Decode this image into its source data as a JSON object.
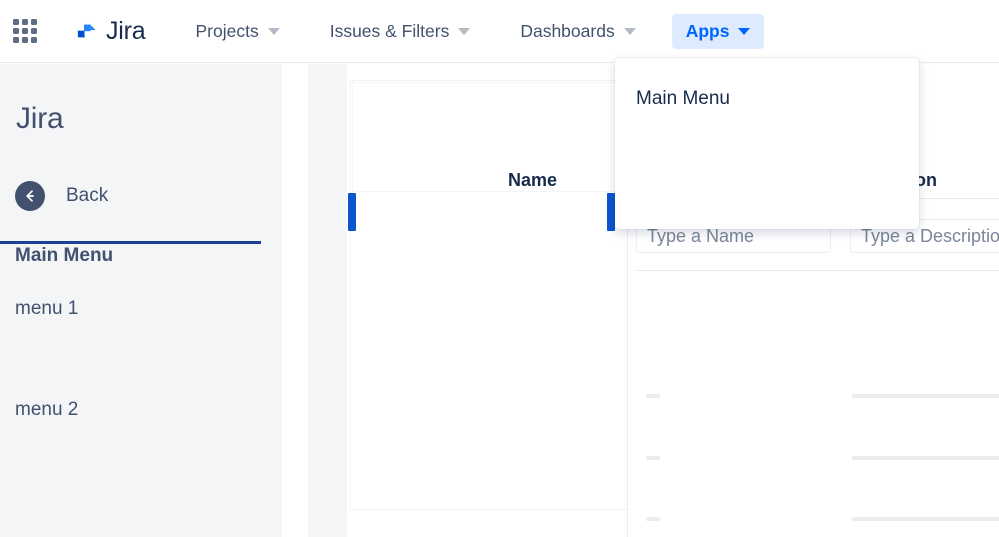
{
  "topnav": {
    "app_switcher_icon": "grid-apps-icon",
    "brand": {
      "logo_icon": "jira-logo-icon",
      "name": "Jira"
    },
    "items": [
      {
        "label": "Projects",
        "icon": "chevron-down-icon",
        "active": false
      },
      {
        "label": "Issues & Filters",
        "icon": "chevron-down-icon",
        "active": false
      },
      {
        "label": "Dashboards",
        "icon": "chevron-down-icon",
        "active": false
      },
      {
        "label": "Apps",
        "icon": "chevron-down-icon",
        "active": true
      }
    ]
  },
  "dropdown": {
    "items": [
      {
        "label": "Main Menu"
      }
    ]
  },
  "sidebar": {
    "title": "Jira",
    "back": {
      "label": "Back",
      "icon": "arrow-left-icon"
    },
    "section_label": "Main Menu",
    "items": [
      {
        "label": "menu 1"
      },
      {
        "label": "menu 2"
      }
    ]
  },
  "content": {
    "table": {
      "headers": {
        "name": "Name",
        "description": "Description"
      },
      "filters": {
        "name_placeholder": "Type a Name",
        "description_placeholder": "Type a Description"
      }
    }
  },
  "colors": {
    "accent_blue": "#0065ff",
    "accent_blue_bg": "#deebff",
    "resize_bar": "#0b54ce",
    "sidebar_bg": "#f4f5f7",
    "divider_navy": "#1d3f94",
    "text_primary": "#172b4d",
    "text_secondary": "#42526e",
    "text_muted": "#7a869a"
  }
}
